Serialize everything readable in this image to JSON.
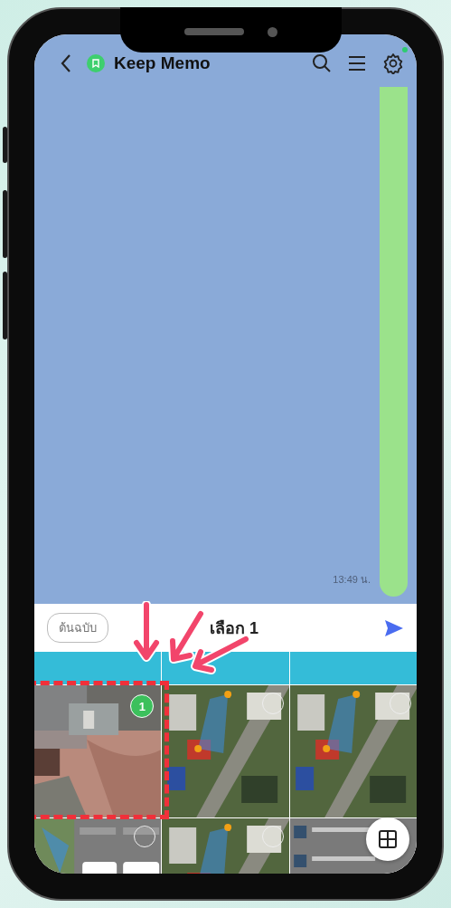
{
  "header": {
    "title": "Keep Memo",
    "settings_badge": true
  },
  "chat": {
    "time": "13:49 น."
  },
  "selection_bar": {
    "original_button": "ต้นฉบับ",
    "selected_label": "เลือก 1"
  },
  "gallery": {
    "rows": [
      [
        {
          "kind": "card"
        },
        {
          "kind": "card"
        },
        {
          "kind": "card"
        }
      ],
      [
        {
          "selected": true,
          "badge": "1"
        },
        {
          "kind": "map",
          "selected": false
        },
        {
          "kind": "map",
          "selected": false
        }
      ],
      [
        {
          "kind": "screens",
          "selected": false
        },
        {
          "kind": "map",
          "selected": false
        },
        {
          "kind": "files"
        }
      ]
    ]
  }
}
